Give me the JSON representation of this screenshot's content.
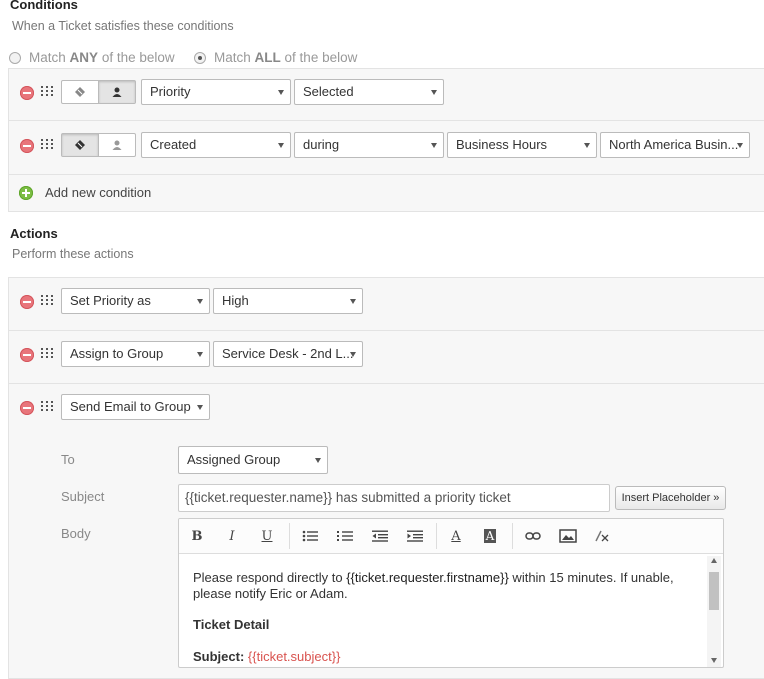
{
  "conditions": {
    "title": "Conditions",
    "subtitle": "When a Ticket satisfies these conditions",
    "match_any_prefix": "Match",
    "match_any_bold": "ANY",
    "match_any_suffix": "of the below",
    "match_all_prefix": "Match",
    "match_all_bold": "ALL",
    "match_all_suffix": "of the below",
    "selected_match": "ALL",
    "rows": [
      {
        "field": "Priority",
        "operator": "Selected",
        "toggle_selected": "requester"
      },
      {
        "field": "Created",
        "operator": "during",
        "value": "Business Hours",
        "calendar": "North America Busin...",
        "toggle_selected": "ticket"
      }
    ],
    "add_label": "Add new condition"
  },
  "actions": {
    "title": "Actions",
    "subtitle": "Perform these actions",
    "rows": [
      {
        "action": "Set Priority as",
        "value": "High"
      },
      {
        "action": "Assign to Group",
        "value": "Service Desk - 2nd L..."
      },
      {
        "action": "Send Email to Group"
      }
    ],
    "email": {
      "to_label": "To",
      "to_value": "Assigned Group",
      "subject_label": "Subject",
      "subject_value": "{{ticket.requester.name}} has submitted a priority ticket",
      "insert_placeholder": "Insert Placeholder »",
      "body_label": "Body",
      "toolbar": {
        "bold": "B",
        "italic": "I",
        "underline": "U",
        "font_color": "A",
        "bg_color": "A"
      },
      "body": {
        "line1_pre": "Please respond directly to ",
        "line1_ph": "{{ticket.requester.firstname}}",
        "line1_post": " within 15 minutes. If unable,",
        "line2": "please notify Eric or Adam.",
        "heading": "Ticket Detail",
        "subject_label": "Subject: ",
        "subject_ph": "{{ticket.subject}}"
      }
    }
  },
  "colors": {
    "remove": "#e8757b",
    "add": "#7cbd44",
    "placeholder_red": "#d9534f"
  }
}
